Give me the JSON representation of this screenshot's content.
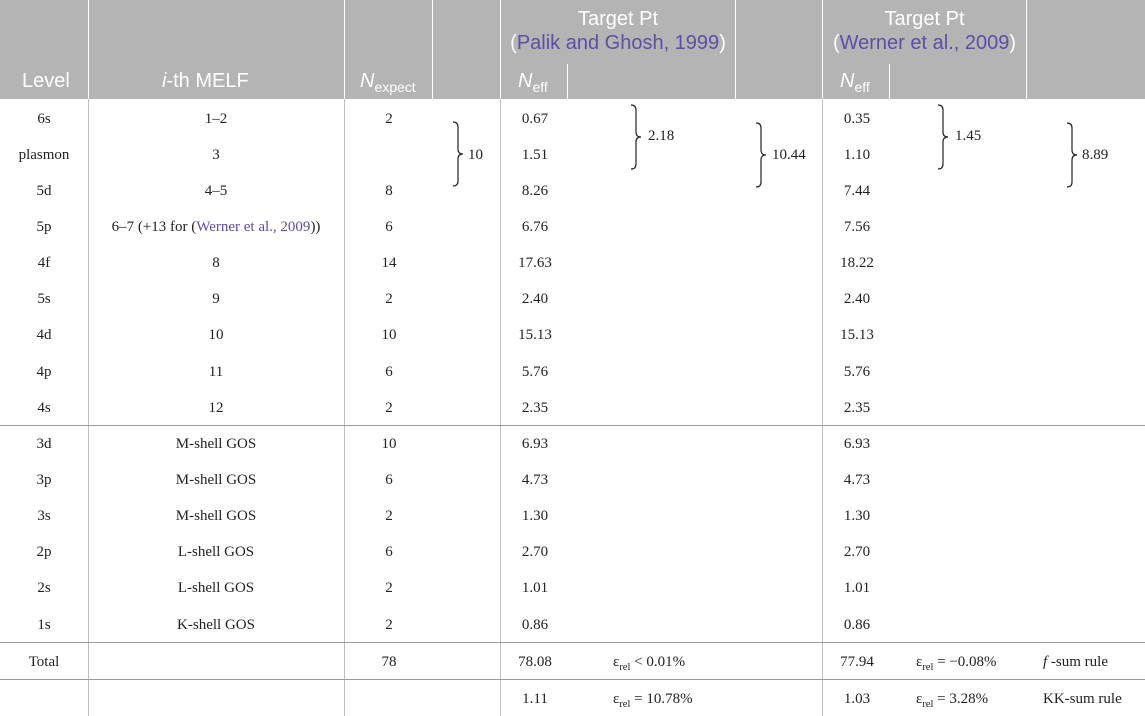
{
  "header": {
    "level": "Level",
    "melf_i": "i",
    "melf_rest": "-th MELF",
    "nexpect_n": "N",
    "nexpect_sub": "expect",
    "target1_title": "Target Pt",
    "target1_open": "(",
    "target1_ref": "Palik and Ghosh, 1999",
    "target1_close": ")",
    "target2_title": "Target Pt",
    "target2_open": "(",
    "target2_ref": "Werner et al., 2009",
    "target2_close": ")",
    "neff_n": "N",
    "neff_sub": "eff"
  },
  "rows": [
    {
      "level": "6s",
      "melf": "1–2",
      "nexp": "2",
      "n1": "0.67",
      "n2": "0.35"
    },
    {
      "level": "plasmon",
      "melf": "3",
      "nexp": "",
      "n1": "1.51",
      "n2": "1.10"
    },
    {
      "level": "5d",
      "melf": "4–5",
      "nexp": "8",
      "n1": "8.26",
      "n2": "7.44"
    },
    {
      "level": "5p",
      "melf_pre": "6–7 (+13 for (",
      "melf_link": "Werner et al., 2009",
      "melf_post": "))",
      "nexp": "6",
      "n1": "6.76",
      "n2": "7.56"
    },
    {
      "level": "4f",
      "melf": "8",
      "nexp": "14",
      "n1": "17.63",
      "n2": "18.22"
    },
    {
      "level": "5s",
      "melf": "9",
      "nexp": "2",
      "n1": "2.40",
      "n2": "2.40"
    },
    {
      "level": "4d",
      "melf": "10",
      "nexp": "10",
      "n1": "15.13",
      "n2": "15.13"
    },
    {
      "level": "4p",
      "melf": "11",
      "nexp": "6",
      "n1": "5.76",
      "n2": "5.76"
    },
    {
      "level": "4s",
      "melf": "12",
      "nexp": "2",
      "n1": "2.35",
      "n2": "2.35"
    },
    {
      "level": "3d",
      "melf": "M-shell GOS",
      "nexp": "10",
      "n1": "6.93",
      "n2": "6.93"
    },
    {
      "level": "3p",
      "melf": "M-shell GOS",
      "nexp": "6",
      "n1": "4.73",
      "n2": "4.73"
    },
    {
      "level": "3s",
      "melf": "M-shell GOS",
      "nexp": "2",
      "n1": "1.30",
      "n2": "1.30"
    },
    {
      "level": "2p",
      "melf": "L-shell GOS",
      "nexp": "6",
      "n1": "2.70",
      "n2": "2.70"
    },
    {
      "level": "2s",
      "melf": "L-shell GOS",
      "nexp": "2",
      "n1": "1.01",
      "n2": "1.01"
    },
    {
      "level": "1s",
      "melf": "K-shell GOS",
      "nexp": "2",
      "n1": "0.86",
      "n2": "0.86"
    }
  ],
  "groups": {
    "nexp_sum": "10",
    "pg_small": "2.18",
    "pg_large": "10.44",
    "w_small": "1.45",
    "w_large": "8.89"
  },
  "total": {
    "label": "Total",
    "nexp": "78",
    "n1": "78.08",
    "e1_eps": "ε",
    "e1_sub": "rel",
    "e1_val": " < 0.01%",
    "n2": "77.94",
    "e2_eps": "ε",
    "e2_sub": "rel",
    "e2_val": " = −0.08%",
    "rule_f": "f",
    "rule_rest": " -sum rule"
  },
  "kk": {
    "n1": "1.11",
    "e1_eps": "ε",
    "e1_sub": "rel",
    "e1_val": " = 10.78%",
    "n2": "1.03",
    "e2_eps": "ε",
    "e2_sub": "rel",
    "e2_val": " = 3.28%",
    "rule": "KK-sum rule"
  },
  "colors": {
    "header_bg": "#b4b4b4",
    "header_text": "#ffffff",
    "link": "#5b4fa8"
  }
}
